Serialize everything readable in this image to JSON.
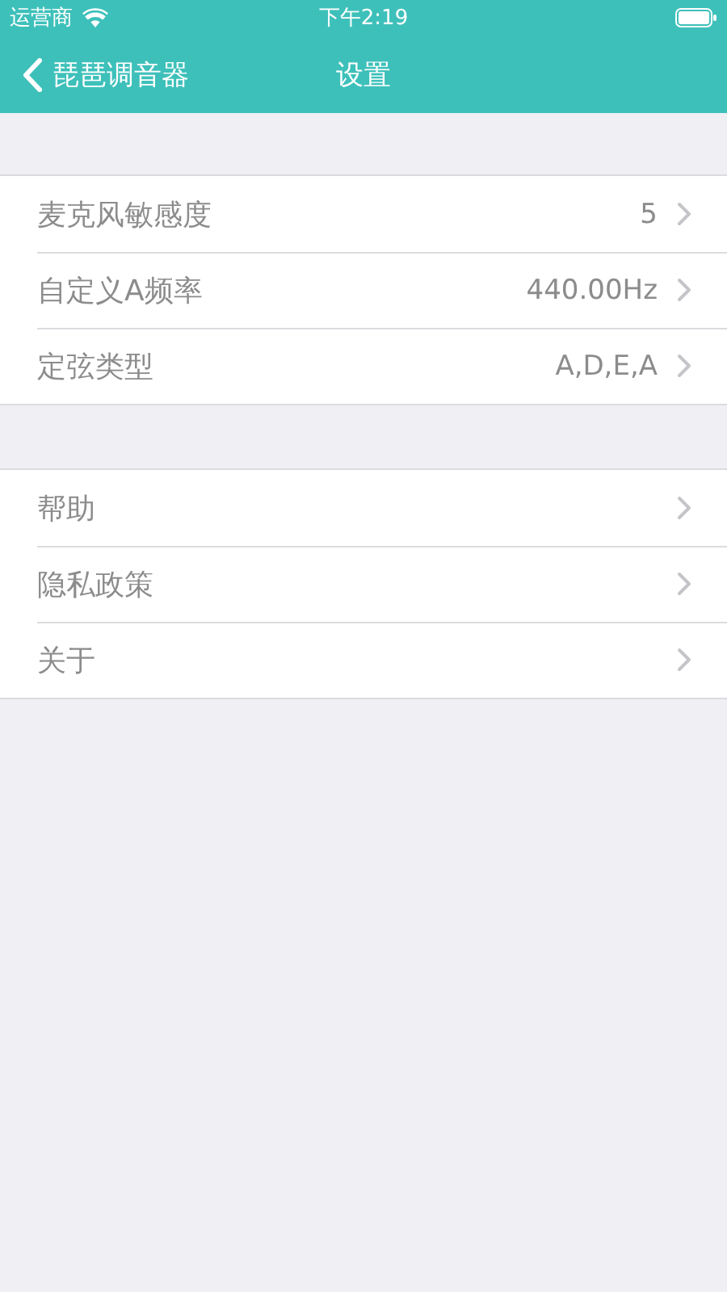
{
  "status_bar": {
    "carrier": "运营商",
    "time": "下午2:19"
  },
  "nav_bar": {
    "back_label": "琵琶调音器",
    "title": "设置"
  },
  "sections": [
    {
      "rows": [
        {
          "label": "麦克风敏感度",
          "value": "5"
        },
        {
          "label": "自定义A频率",
          "value": "440.00Hz"
        },
        {
          "label": "定弦类型",
          "value": "A,D,E,A"
        }
      ]
    },
    {
      "rows": [
        {
          "label": "帮助"
        },
        {
          "label": "隐私政策"
        },
        {
          "label": "关于"
        }
      ]
    }
  ]
}
